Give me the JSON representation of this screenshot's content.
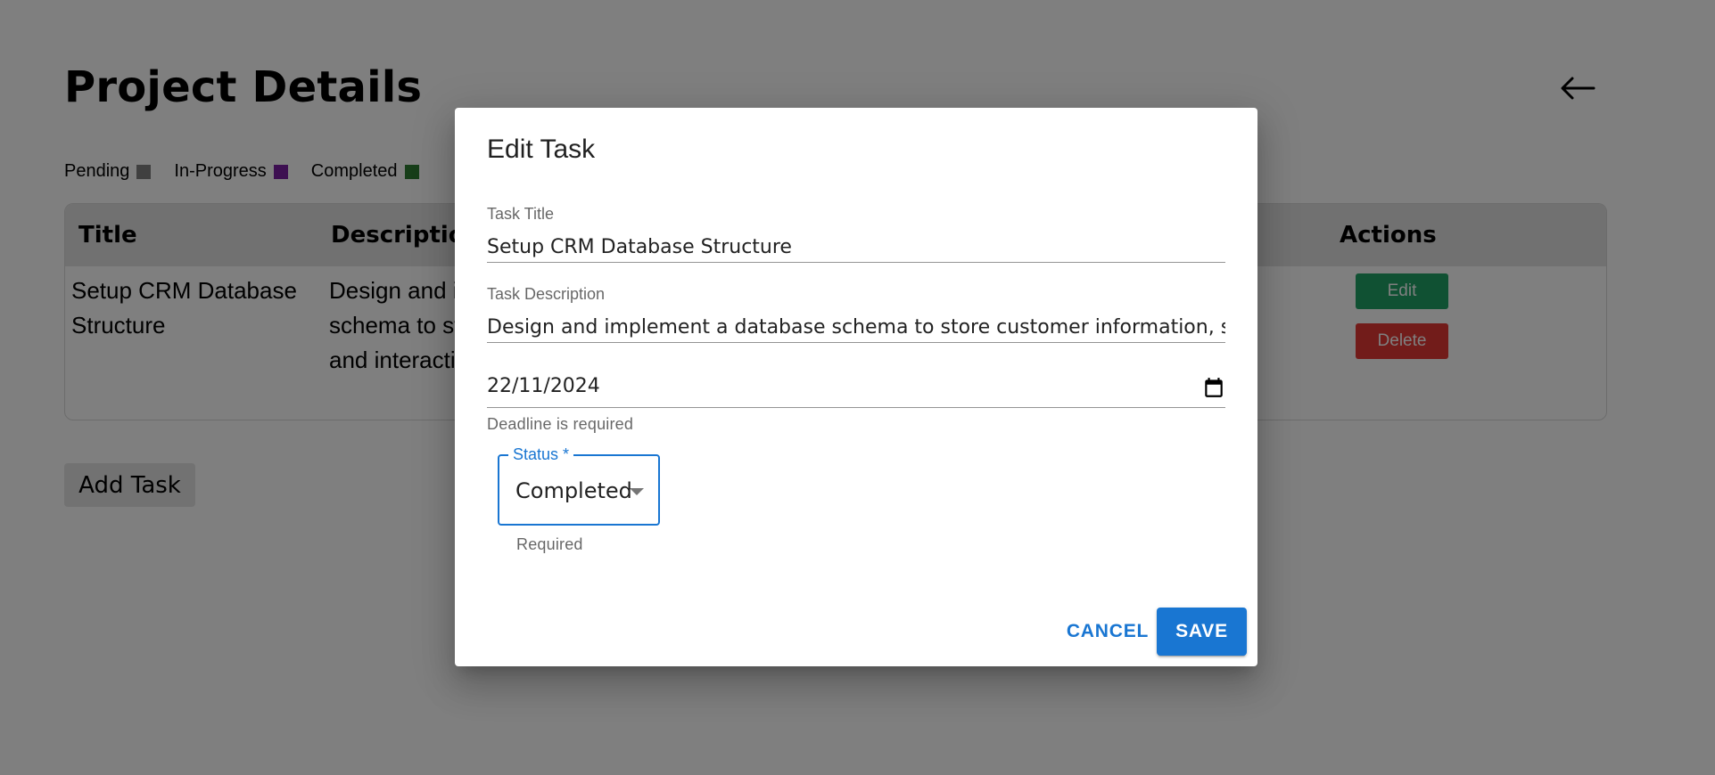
{
  "page": {
    "title": "Project Details",
    "back_icon": "arrow-left-icon"
  },
  "legend": [
    {
      "label": "Pending",
      "color": "#808080"
    },
    {
      "label": "In-Progress",
      "color": "#7b1fa2"
    },
    {
      "label": "Completed",
      "color": "#2e7d32"
    }
  ],
  "table": {
    "headers": {
      "title": "Title",
      "description": "Description",
      "actions": "Actions"
    },
    "rows": [
      {
        "title": "Setup CRM Database Structure",
        "description": "Design and implement a database schema to store customer information and interaction",
        "edit_label": "Edit",
        "delete_label": "Delete"
      }
    ]
  },
  "add_task_label": "Add Task",
  "dialog": {
    "title": "Edit Task",
    "task_title_label": "Task Title",
    "task_title_value": "Setup CRM Database Structure",
    "task_description_label": "Task Description",
    "task_description_value": "Design and implement a database schema to store customer information, sa",
    "deadline_value": "22/11/2024",
    "deadline_helper": "Deadline is required",
    "status_label": "Status *",
    "status_value": "Completed",
    "status_helper": "Required",
    "cancel_label": "CANCEL",
    "save_label": "SAVE"
  },
  "colors": {
    "accent": "#1976d2",
    "edit": "#21a366",
    "delete": "#e53935"
  }
}
